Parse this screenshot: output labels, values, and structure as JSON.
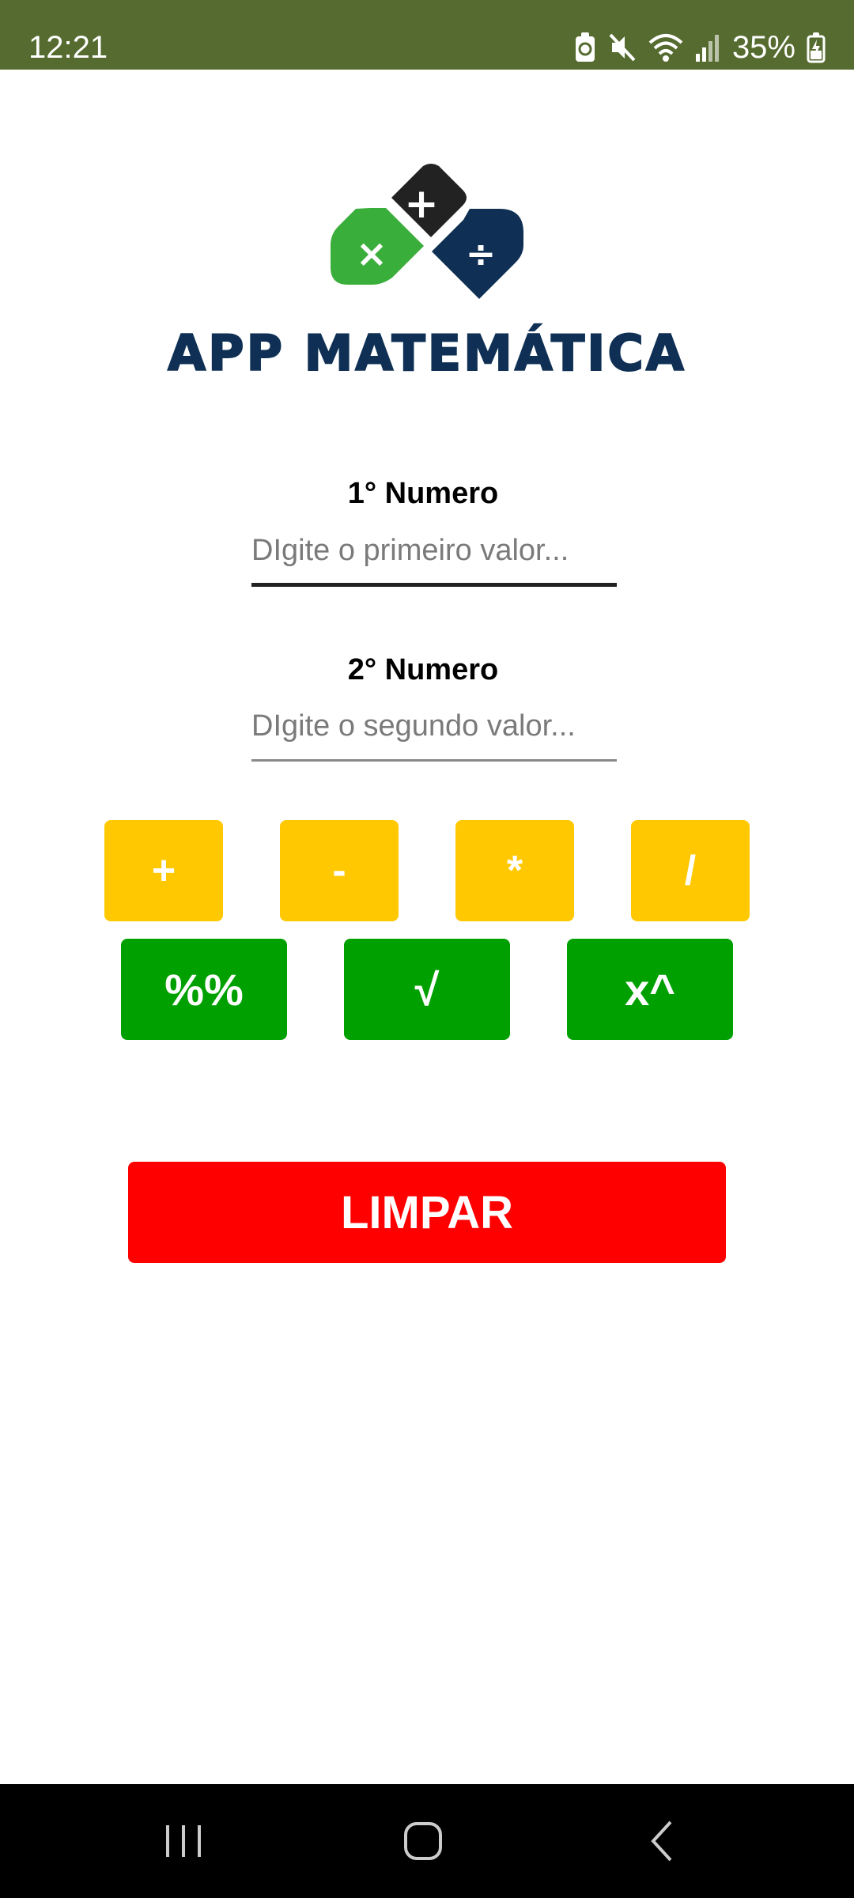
{
  "status_bar": {
    "time": "12:21",
    "battery": "35%",
    "icons": [
      "battery-saver-icon",
      "mute-icon",
      "wifi-icon",
      "signal-icon",
      "battery-charging-icon"
    ]
  },
  "logo": {
    "title": "APP MATEMÁTICA",
    "symbols": {
      "top": "+",
      "left": "×",
      "right": "÷"
    },
    "colors": {
      "top": "#222222",
      "left": "#3aae3a",
      "right": "#0f3054"
    }
  },
  "form": {
    "first": {
      "label": "1° Numero",
      "placeholder": "DIgite o primeiro valor...",
      "value": ""
    },
    "second": {
      "label": "2° Numero",
      "placeholder": "DIgite o segundo valor...",
      "value": ""
    }
  },
  "operations": {
    "add": "+",
    "subtract": "-",
    "multiply": "*",
    "divide": "/",
    "percent": "%%",
    "sqrt": "√",
    "power": "x^"
  },
  "clear_button": "LIMPAR",
  "colors": {
    "status_bar": "#556b2f",
    "op_primary": "#ffc800",
    "op_secondary": "#00a000",
    "clear": "#ff0000",
    "nav_bar": "#000000"
  },
  "nav_bar": {
    "icons": [
      "recent-apps-icon",
      "home-icon",
      "back-icon"
    ]
  }
}
